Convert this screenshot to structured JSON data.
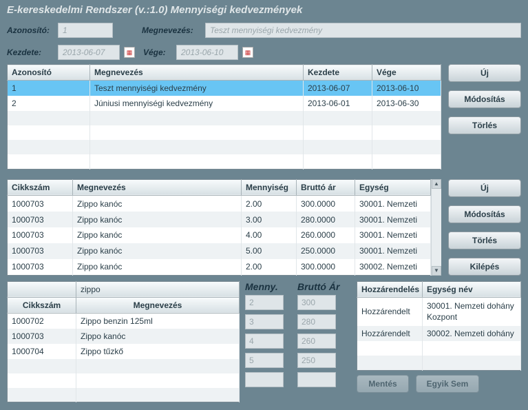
{
  "title": "E-kereskedelmi Rendszer (v.:1.0)   Mennyiségi kedvezmények",
  "form": {
    "id_label": "Azonosító:",
    "id_value": "1",
    "name_label": "Megnevezés:",
    "name_value": "Teszt mennyiségi kedvezmény",
    "start_label": "Kezdete:",
    "start_value": "2013-06-07",
    "end_label": "Vége:",
    "end_value": "2013-06-10"
  },
  "discounts": {
    "cols": [
      "Azonosító",
      "Megnevezés",
      "Kezdete",
      "Vége"
    ],
    "rows": [
      [
        "1",
        "Teszt mennyiségi kedvezmény",
        "2013-06-07",
        "2013-06-10"
      ],
      [
        "2",
        "Júniusi mennyiségi kedvezmény",
        "2013-06-01",
        "2013-06-30"
      ]
    ]
  },
  "btns": {
    "new": "Új",
    "edit": "Módosítás",
    "del": "Törlés",
    "exit": "Kilépés",
    "mentes": "Mentés",
    "egyik": "Egyik Sem"
  },
  "items": {
    "cols": [
      "Cikkszám",
      "Megnevezés",
      "Mennyiség",
      "Bruttó ár",
      "Egység"
    ],
    "rows": [
      [
        "1000703",
        "Zippo kanóc",
        "2.00",
        "300.0000",
        "30001. Nemzeti"
      ],
      [
        "1000703",
        "Zippo kanóc",
        "3.00",
        "280.0000",
        "30001. Nemzeti"
      ],
      [
        "1000703",
        "Zippo kanóc",
        "4.00",
        "260.0000",
        "30001. Nemzeti"
      ],
      [
        "1000703",
        "Zippo kanóc",
        "5.00",
        "250.0000",
        "30001. Nemzeti"
      ],
      [
        "1000703",
        "Zippo kanóc",
        "2.00",
        "300.0000",
        "30002. Nemzeti"
      ]
    ]
  },
  "search": {
    "filter": "zippo",
    "cols": [
      "Cikkszám",
      "Megnevezés"
    ],
    "rows": [
      [
        "1000702",
        "Zippo benzin 125ml"
      ],
      [
        "1000703",
        "Zippo kanóc"
      ],
      [
        "1000704",
        "Zippo tűzkő"
      ]
    ]
  },
  "pricing": {
    "qty_label": "Menny.",
    "price_label": "Bruttó Ár",
    "rows": [
      [
        "2",
        "300"
      ],
      [
        "3",
        "280"
      ],
      [
        "4",
        "260"
      ],
      [
        "5",
        "250"
      ],
      [
        "",
        ""
      ]
    ]
  },
  "assign": {
    "cols": [
      "Hozzárendelés",
      "Egység név"
    ],
    "rows": [
      [
        "Hozzárendelt",
        "30001. Nemzeti dohány Kozpont"
      ],
      [
        "Hozzárendelt",
        "30002. Nemzeti dohány"
      ]
    ]
  }
}
